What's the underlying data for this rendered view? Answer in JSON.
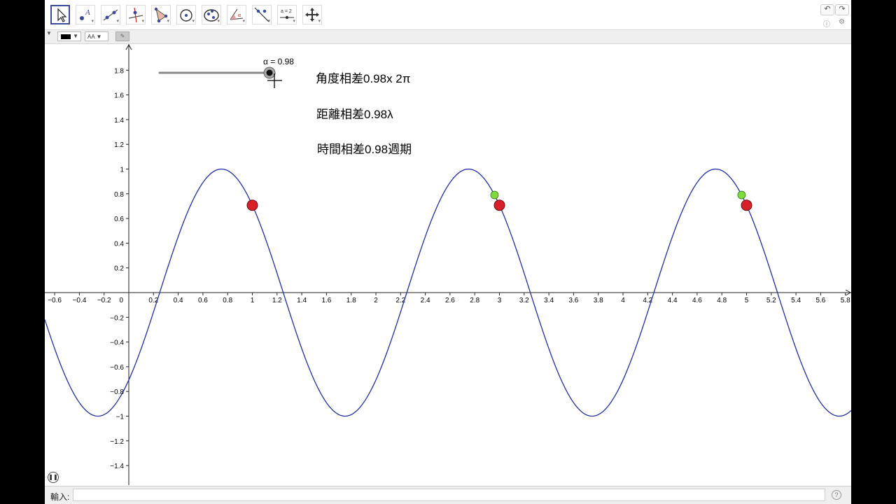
{
  "toolbar": {
    "tools": [
      {
        "name": "move-tool",
        "selected": true
      },
      {
        "name": "point-tool"
      },
      {
        "name": "line-tool"
      },
      {
        "name": "perpendicular-line-tool"
      },
      {
        "name": "polygon-tool"
      },
      {
        "name": "circle-tool"
      },
      {
        "name": "conic-tool"
      },
      {
        "name": "angle-tool"
      },
      {
        "name": "reflect-tool"
      },
      {
        "name": "slider-tool",
        "label": "a = 2"
      },
      {
        "name": "move-graphics-view-tool"
      }
    ],
    "undo_icon": "undo-icon",
    "redo_icon": "redo-icon",
    "help_icon": "help-icon",
    "settings_icon": "gear-icon"
  },
  "stylebar": {
    "color": "#000000",
    "text_style_label": "AA"
  },
  "slider": {
    "label": "α = 0.98",
    "value": 0.98,
    "min": 0,
    "max": 1
  },
  "texts": {
    "angle": "角度相差0.98x 2π",
    "distance": "距離相差0.98λ",
    "time": "時間相差0.98週期"
  },
  "graph": {
    "function": "y = sin(π(x − 0.25)), period 2",
    "curve_color": "#1f2fa8",
    "x_ticks": [
      "−0.6",
      "−0.4",
      "−0.2",
      "0",
      "0.2",
      "0.4",
      "0.6",
      "0.8",
      "1",
      "1.2",
      "1.4",
      "1.6",
      "1.8",
      "2",
      "2.2",
      "2.4",
      "2.6",
      "2.8",
      "3",
      "3.2",
      "3.4",
      "3.6",
      "3.8",
      "4",
      "4.2",
      "4.4",
      "4.6",
      "4.8",
      "5",
      "5.2",
      "5.4",
      "5.6",
      "5.8"
    ],
    "y_ticks": [
      "1.8",
      "1.6",
      "1.4",
      "1.2",
      "1",
      "0.8",
      "0.6",
      "0.4",
      "0.2",
      "−0.2",
      "−0.4",
      "−0.6",
      "−0.8",
      "−1",
      "−1.2",
      "−1.4"
    ],
    "red_points": [
      {
        "x": 1,
        "y": 0.707
      },
      {
        "x": 3,
        "y": 0.707
      },
      {
        "x": 5,
        "y": 0.707
      }
    ],
    "green_points": [
      {
        "x": 2.96,
        "y": 0.79
      },
      {
        "x": 4.96,
        "y": 0.79
      }
    ],
    "red_color": "#d7202a",
    "green_color": "#7ddc3c"
  },
  "inputbar": {
    "label": "輸入:",
    "value": "",
    "help_icon": "help-icon"
  },
  "play_icon": "pause-icon"
}
